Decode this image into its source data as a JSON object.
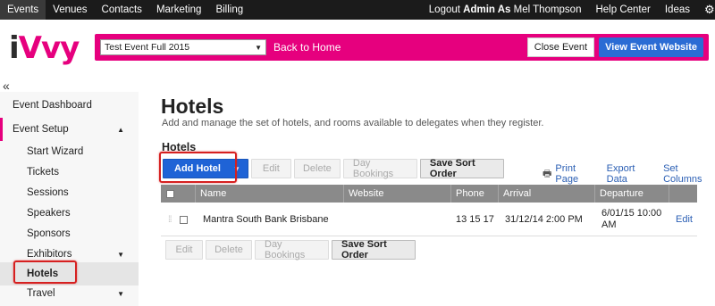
{
  "topnav": {
    "items": [
      "Events",
      "Venues",
      "Contacts",
      "Marketing",
      "Billing"
    ],
    "logout_prefix": "Logout",
    "admin_as": "Admin As",
    "user_name": "Mel Thompson",
    "help": "Help Center",
    "ideas": "Ideas",
    "gear_icon": "gear-icon"
  },
  "header": {
    "logo_a": "i",
    "logo_b": "Vvy",
    "event_selected": "Test Event Full 2015",
    "back_home": "Back to Home",
    "close_event": "Close Event",
    "view_site": "View Event Website",
    "brand_color": "#e6007e"
  },
  "sidebar": {
    "collapse_icon": "«",
    "items": [
      {
        "label": "Event Dashboard"
      },
      {
        "label": "Event Setup"
      },
      {
        "label": "Start Wizard"
      },
      {
        "label": "Tickets"
      },
      {
        "label": "Sessions"
      },
      {
        "label": "Speakers"
      },
      {
        "label": "Sponsors"
      },
      {
        "label": "Exhibitors"
      },
      {
        "label": "Hotels"
      },
      {
        "label": "Travel"
      }
    ]
  },
  "main": {
    "title": "Hotels",
    "subtitle": "Add and manage the set of hotels, and rooms available to delegates when they register.",
    "section_title": "Hotels",
    "toolbar": {
      "add": "Add Hotel",
      "edit": "Edit",
      "delete": "Delete",
      "day_bookings": "Day Bookings",
      "save_sort": "Save Sort Order"
    },
    "links": {
      "print": "Print Page",
      "export": "Export Data",
      "columns": "Set Columns"
    },
    "table": {
      "headers": [
        "Name",
        "Website",
        "Phone",
        "Arrival",
        "Departure"
      ],
      "rows": [
        {
          "name": "Mantra South Bank Brisbane",
          "website": "",
          "phone": "13 15 17",
          "arrival": "31/12/14 2:00 PM",
          "departure_1": "6/01/15 10:00",
          "departure_2": "AM",
          "action": "Edit"
        }
      ]
    }
  }
}
